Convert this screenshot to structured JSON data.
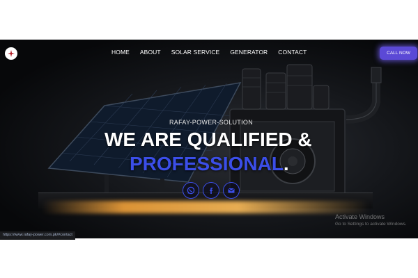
{
  "nav": {
    "links": [
      "HOME",
      "ABOUT",
      "SOLAR SERVICE",
      "GENERATOR",
      "CONTACT"
    ],
    "cta": "CALL NOW"
  },
  "hero": {
    "subtitle": "RAFAY-POWER-SOLUTION",
    "title_line1": "WE ARE QUALIFIED &",
    "title_line2": "PROFESSIONAL",
    "title_line2_end": "."
  },
  "socials": [
    "whatsapp-icon",
    "facebook-icon",
    "mail-icon"
  ],
  "status_bar": {
    "url": "https://www.rafay-power.com.pk/#contact"
  },
  "os_watermark": {
    "line1": "Activate Windows",
    "line2": "Go to Settings to activate Windows."
  },
  "colors": {
    "accent": "#3b4ee8",
    "cta_bg": "#5b49d6",
    "background": "#0d0e10"
  }
}
